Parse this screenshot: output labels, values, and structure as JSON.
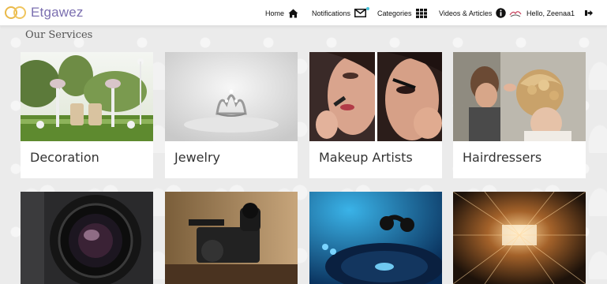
{
  "brand": {
    "name": "Etgawez",
    "accent": "#7b6fb0",
    "ring_color": "#e9b949"
  },
  "nav": {
    "home": "Home",
    "notifications": "Notifications",
    "categories": "Categories",
    "videos": "Videos & Articles",
    "greeting": "Hello, Zeenaa1"
  },
  "section": {
    "title": "Our Services"
  },
  "services": [
    {
      "label": "Decoration",
      "image": "garden-wedding-chairs"
    },
    {
      "label": "Jewelry",
      "image": "crystal-tiara"
    },
    {
      "label": "Makeup Artists",
      "image": "makeup-application"
    },
    {
      "label": "Hairdressers",
      "image": "bridal-updo"
    },
    {
      "label": "",
      "image": "camera-lens"
    },
    {
      "label": "",
      "image": "video-camcorder"
    },
    {
      "label": "",
      "image": "dj-turntable"
    },
    {
      "label": "",
      "image": "light-tunnel-hall"
    }
  ]
}
